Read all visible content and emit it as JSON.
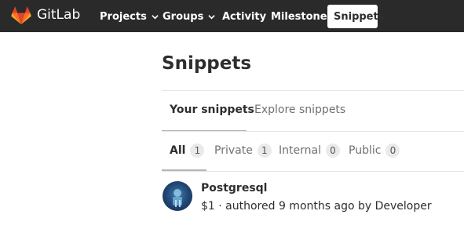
{
  "brand": {
    "name": "GitLab",
    "logo_icon": "gitlab-logo-icon"
  },
  "nav": {
    "projects": "Projects",
    "groups": "Groups",
    "activity": "Activity",
    "milestones": "Milestones",
    "snippets": "Snippets"
  },
  "page": {
    "title": "Snippets"
  },
  "tabs": {
    "your_snippets": "Your snippets",
    "explore_snippets": "Explore snippets"
  },
  "filters": [
    {
      "label": "All",
      "count": "1"
    },
    {
      "label": "Private",
      "count": "1"
    },
    {
      "label": "Internal",
      "count": "0"
    },
    {
      "label": "Public",
      "count": "0"
    }
  ],
  "snippet": {
    "title": "Postgresql",
    "meta": "$1 · authored 9 months ago by Developer"
  },
  "colors": {
    "topbar": "#2a2a2a",
    "gitlab_orange": "#e24329"
  }
}
